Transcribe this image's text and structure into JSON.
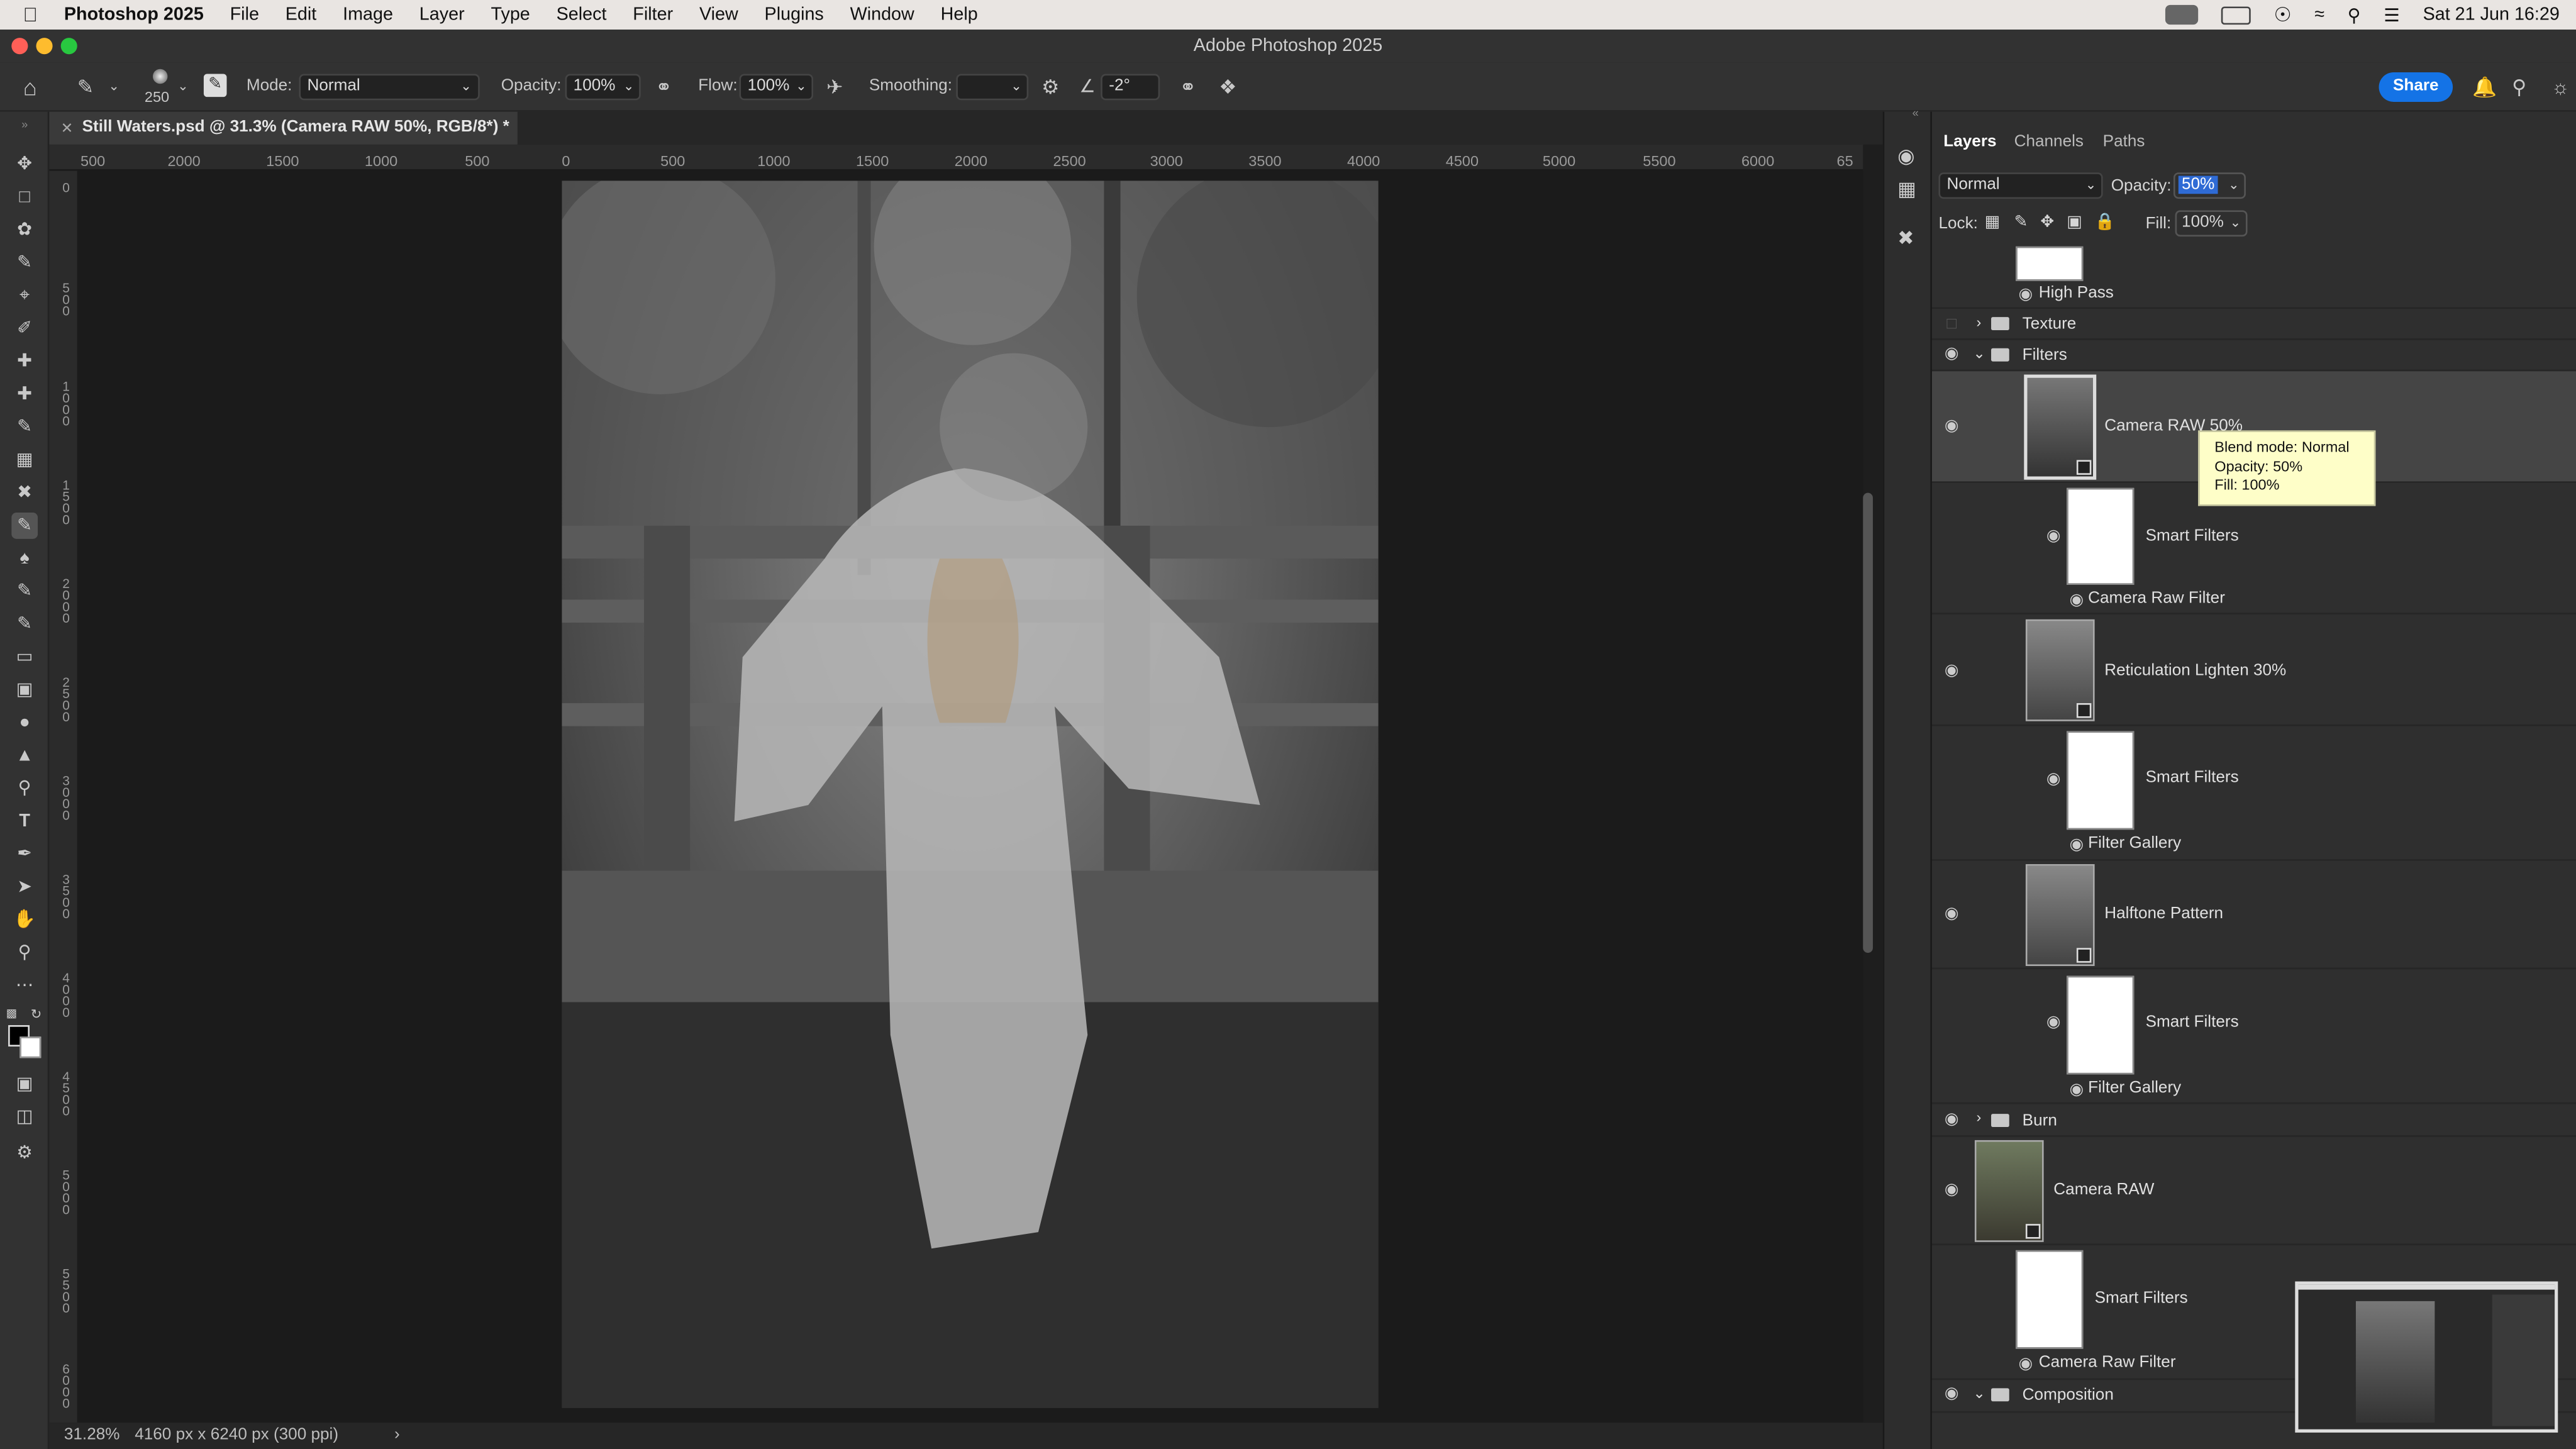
{
  "menubar": {
    "app_name": "Photoshop 2025",
    "items": [
      "File",
      "Edit",
      "Image",
      "Layer",
      "Type",
      "Select",
      "Filter",
      "View",
      "Plugins",
      "Window",
      "Help"
    ],
    "clock": "Sat 21 Jun  16:29"
  },
  "window": {
    "title": "Adobe Photoshop 2025"
  },
  "options": {
    "brush_size": "250",
    "mode_label": "Mode:",
    "mode_value": "Normal",
    "opacity_label": "Opacity:",
    "opacity_value": "100%",
    "flow_label": "Flow:",
    "flow_value": "100%",
    "smoothing_label": "Smoothing:",
    "smoothing_value": "",
    "angle_value": "-2°",
    "share_label": "Share"
  },
  "document": {
    "tab_title": "Still Waters.psd @ 31.3% (Camera RAW 50%, RGB/8*) *",
    "zoom": "31.28%",
    "info": "4160 px x 6240 px (300 ppi)"
  },
  "ruler": {
    "top_ticks": [
      "500",
      "2000",
      "1500",
      "1000",
      "500",
      "0",
      "500",
      "1000",
      "1500",
      "2000",
      "2500",
      "3000",
      "3500",
      "4000",
      "4500",
      "5000",
      "5500",
      "6000",
      "65"
    ],
    "left_ticks": [
      "0",
      "5\n0\n0",
      "1\n0\n0\n0",
      "1\n5\n0\n0",
      "2\n0\n0\n0",
      "2\n5\n0\n0",
      "3\n0\n0\n0",
      "3\n5\n0\n0",
      "4\n0\n0\n0",
      "4\n5\n0\n0",
      "5\n0\n0\n0",
      "5\n5\n0\n0",
      "6\n0\n0\n0"
    ]
  },
  "panel": {
    "tabs": [
      "Layers",
      "Channels",
      "Paths"
    ],
    "blend_mode": "Normal",
    "opacity_label": "Opacity:",
    "opacity_value": "50%",
    "lock_label": "Lock:",
    "fill_label": "Fill:",
    "fill_value": "100%",
    "layers": {
      "high_pass": "High Pass",
      "texture": "Texture",
      "filters": "Filters",
      "camera_raw_50": "Camera RAW 50%",
      "smart_filters_1": "Smart Filters",
      "camera_raw_filter_1": "Camera Raw Filter",
      "reticulation": "Reticulation Lighten 30%",
      "smart_filters_2": "Smart Filters",
      "filter_gallery_1": "Filter Gallery",
      "halftone": "Halftone Pattern",
      "smart_filters_3": "Smart Filters",
      "filter_gallery_2": "Filter Gallery",
      "burn": "Burn",
      "camera_raw": "Camera RAW",
      "smart_filters_4": "Smart Filters",
      "camera_raw_filter_2": "Camera Raw Filter",
      "composition": "Composition"
    }
  },
  "tooltip": {
    "line1": "Blend mode: Normal",
    "line2": "Opacity: 50%",
    "line3": "Fill: 100%"
  }
}
